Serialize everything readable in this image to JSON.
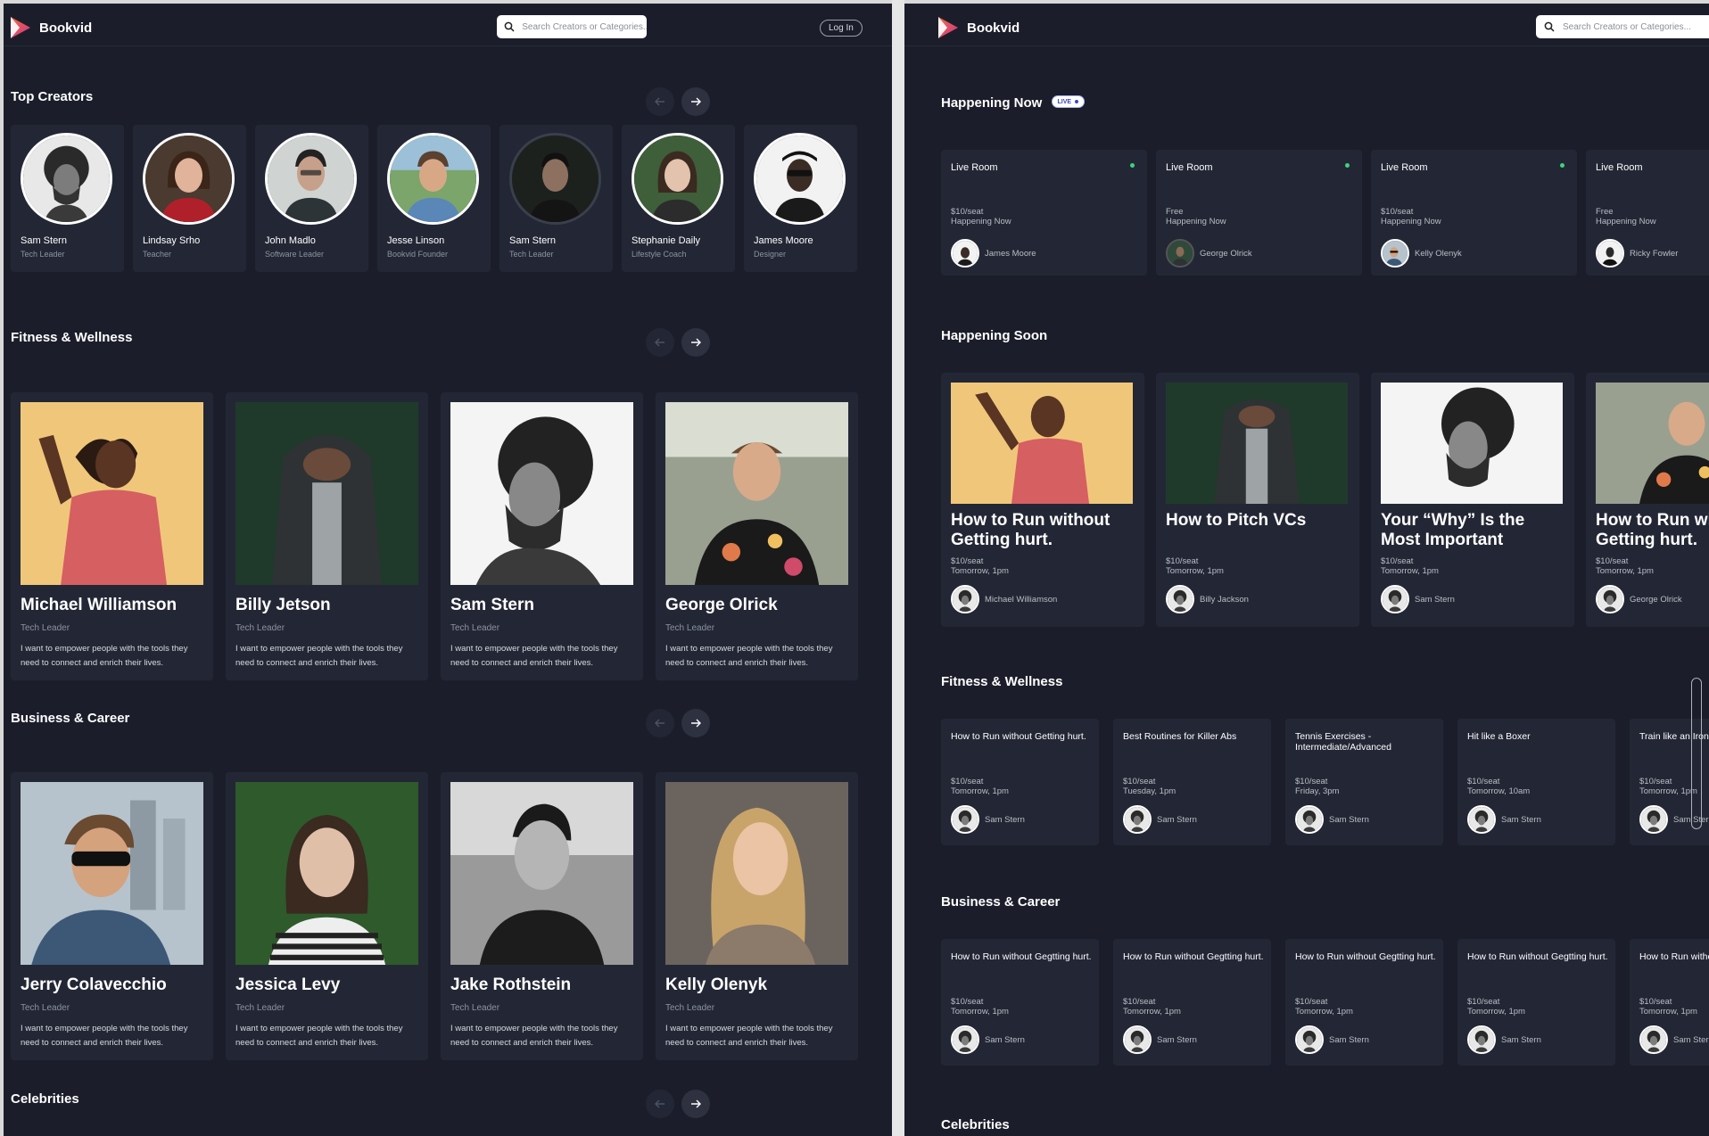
{
  "brand": {
    "name": "Bookvid",
    "colors": {
      "background": "#1b1e2a",
      "card": "#232735",
      "live_dot": "#3ed37a",
      "logo_pink": "#e0457b",
      "logo_orange": "#f26b3a"
    }
  },
  "left": {
    "search_placeholder": "Search Creators or Categories...",
    "login_label": "Log In",
    "top_creators": {
      "title": "Top Creators",
      "items": [
        {
          "name": "Sam Stern",
          "role": "Tech Leader"
        },
        {
          "name": "Lindsay Srho",
          "role": "Teacher"
        },
        {
          "name": "John Madlo",
          "role": "Software Leader"
        },
        {
          "name": "Jesse Linson",
          "role": "Bookvid Founder"
        },
        {
          "name": "Sam Stern",
          "role": "Tech Leader"
        },
        {
          "name": "Stephanie Daily",
          "role": "Lifestyle Coach"
        },
        {
          "name": "James Moore",
          "role": "Designer"
        }
      ]
    },
    "fitness": {
      "title": "Fitness & Wellness",
      "items": [
        {
          "name": "Michael Williamson",
          "role": "Tech Leader",
          "bio": "I want to empower people with the tools they need to connect and enrich their lives."
        },
        {
          "name": "Billy Jetson",
          "role": "Tech Leader",
          "bio": "I want to empower people with the tools they need to connect and enrich their lives."
        },
        {
          "name": "Sam Stern",
          "role": "Tech Leader",
          "bio": "I want to empower people with the tools they need to connect and enrich their lives."
        },
        {
          "name": "George Olrick",
          "role": "Tech Leader",
          "bio": "I want to empower people with the tools they need to connect and enrich their lives."
        }
      ]
    },
    "business": {
      "title": "Business & Career",
      "items": [
        {
          "name": "Jerry Colavecchio",
          "role": "Tech Leader",
          "bio": "I want to empower people with the tools they need to connect and enrich their lives."
        },
        {
          "name": "Jessica Levy",
          "role": "Tech Leader",
          "bio": "I want to empower people with the tools they need to connect and enrich their lives."
        },
        {
          "name": "Jake Rothstein",
          "role": "Tech Leader",
          "bio": "I want to empower people with the tools they need to connect and enrich their lives."
        },
        {
          "name": "Kelly Olenyk",
          "role": "Tech Leader",
          "bio": "I want to empower people with the tools they need to connect and enrich their lives."
        }
      ]
    },
    "celebrities": {
      "title": "Celebrities"
    }
  },
  "right": {
    "search_placeholder": "Search Creators or Categories...",
    "happening_now": {
      "title": "Happening Now",
      "badge": "LIVE",
      "items": [
        {
          "title": "Live Room",
          "price": "$10/seat",
          "when": "Happening Now",
          "host": "James Moore"
        },
        {
          "title": "Live Room",
          "price": "Free",
          "when": "Happening Now",
          "host": "George Olrick"
        },
        {
          "title": "Live Room",
          "price": "$10/seat",
          "when": "Happening Now",
          "host": "Kelly Olenyk"
        },
        {
          "title": "Live Room",
          "price": "Free",
          "when": "Happening Now",
          "host": "Ricky Fowler"
        }
      ]
    },
    "happening_soon": {
      "title": "Happening Soon",
      "items": [
        {
          "title": "How to Run without Getting hurt.",
          "price": "$10/seat",
          "when": "Tomorrow, 1pm",
          "host": "Michael Williamson"
        },
        {
          "title": "How to Pitch VCs",
          "price": "$10/seat",
          "when": "Tomorrow, 1pm",
          "host": "Billy Jackson"
        },
        {
          "title": "Your “Why” Is the Most Important",
          "price": "$10/seat",
          "when": "Tomorrow, 1pm",
          "host": "Sam Stern"
        },
        {
          "title": "How to Run without Getting hurt.",
          "price": "$10/seat",
          "when": "Tomorrow, 1pm",
          "host": "George Olrick"
        }
      ]
    },
    "fitness": {
      "title": "Fitness & Wellness",
      "items": [
        {
          "title": "How to Run without Getting hurt.",
          "price": "$10/seat",
          "when": "Tomorrow, 1pm",
          "host": "Sam Stern"
        },
        {
          "title": "Best Routines for Killer Abs",
          "price": "$10/seat",
          "when": "Tuesday, 1pm",
          "host": "Sam Stern"
        },
        {
          "title": "Tennis Exercises - Intermediate/Advanced",
          "price": "$10/seat",
          "when": "Friday, 3pm",
          "host": "Sam Stern"
        },
        {
          "title": "Hit like a Boxer",
          "price": "$10/seat",
          "when": "Tomorrow, 10am",
          "host": "Sam Stern"
        },
        {
          "title": "Train like an Iron",
          "price": "$10/seat",
          "when": "Tomorrow, 1pm",
          "host": "Sam Stern"
        }
      ]
    },
    "business": {
      "title": "Business & Career",
      "items": [
        {
          "title": "How to Run without Gegtting hurt.",
          "price": "$10/seat",
          "when": "Tomorrow, 1pm",
          "host": "Sam Stern"
        },
        {
          "title": "How to Run without Gegtting hurt.",
          "price": "$10/seat",
          "when": "Tomorrow, 1pm",
          "host": "Sam Stern"
        },
        {
          "title": "How to Run without Gegtting hurt.",
          "price": "$10/seat",
          "when": "Tomorrow, 1pm",
          "host": "Sam Stern"
        },
        {
          "title": "How to Run without Gegtting hurt.",
          "price": "$10/seat",
          "when": "Tomorrow, 1pm",
          "host": "Sam Stern"
        },
        {
          "title": "How to Run without Gegtting hurt.",
          "price": "$10/seat",
          "when": "Tomorrow, 1pm",
          "host": "Sam Stern"
        }
      ]
    },
    "celebrities": {
      "title": "Celebrities"
    }
  }
}
